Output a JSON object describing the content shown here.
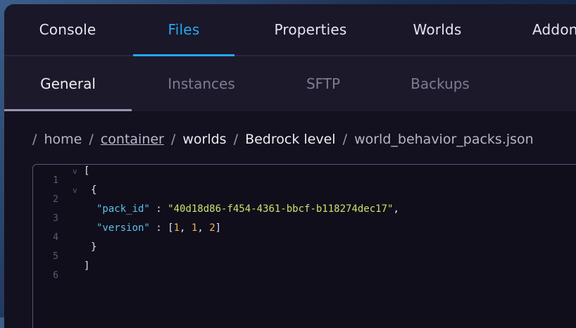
{
  "tabs": [
    {
      "label": "Console"
    },
    {
      "label": "Files"
    },
    {
      "label": "Properties"
    },
    {
      "label": "Worlds"
    },
    {
      "label": "Addons"
    }
  ],
  "subtabs": [
    {
      "label": "General"
    },
    {
      "label": "Instances"
    },
    {
      "label": "SFTP"
    },
    {
      "label": "Backups"
    }
  ],
  "breadcrumb": {
    "separator": "/",
    "home": "home",
    "container": "container",
    "worlds": "worlds",
    "bedrock": "Bedrock level",
    "file": "world_behavior_packs.json"
  },
  "editor": {
    "line_numbers": [
      "1",
      "2",
      "3",
      "4",
      "5",
      "6"
    ],
    "fold_glyph": "v",
    "lines": {
      "l1": "[",
      "l2": "{",
      "l3_key": "\"pack_id\"",
      "l3_colon": " : ",
      "l3_val": "\"40d18d86-f454-4361-bbcf-b118274dec17\"",
      "l3_comma": ",",
      "l4_key": "\"version\"",
      "l4_colon": " : ",
      "l4_open": "[",
      "l4_n1": "1",
      "l4_c1": ", ",
      "l4_n2": "1",
      "l4_c2": ", ",
      "l4_n3": "2",
      "l4_close": "]",
      "l5": "}",
      "l6": "]"
    }
  },
  "colors": {
    "accent": "#27a8f0",
    "key": "#5cc2e6",
    "string": "#c9e46c",
    "number": "#f0b250"
  }
}
